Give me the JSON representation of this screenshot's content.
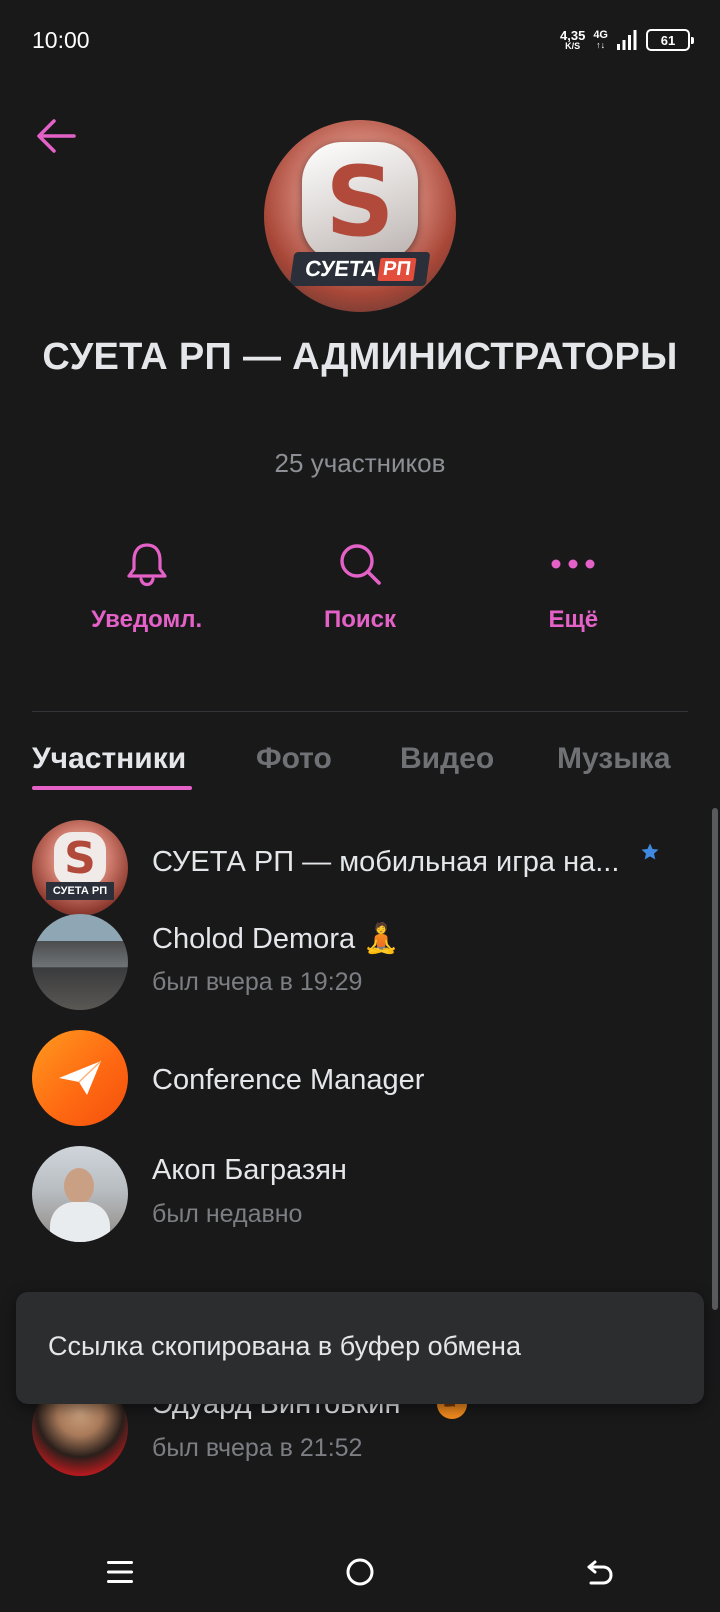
{
  "status_bar": {
    "time": "10:00",
    "net_speed_value": "4,35",
    "net_speed_unit": "K/S",
    "network_type": "4G",
    "network_arrows": "↑↓",
    "battery_level": "61"
  },
  "group": {
    "title": "СУЕТА РП — АДМИНИСТРАТОРЫ",
    "members_count": "25 участников",
    "avatar_logo_text_1": "СУЕТА",
    "avatar_logo_text_2": "РП"
  },
  "actions": [
    {
      "label": "Уведомл.",
      "icon": "bell-icon"
    },
    {
      "label": "Поиск",
      "icon": "search-icon"
    },
    {
      "label": "Ещё",
      "icon": "more-dots-icon"
    }
  ],
  "tabs": [
    {
      "label": "Участники",
      "active": true
    },
    {
      "label": "Фото",
      "active": false
    },
    {
      "label": "Видео",
      "active": false
    },
    {
      "label": "Музыка",
      "active": false
    }
  ],
  "members": [
    {
      "name": "СУЕТА РП — мобильная игра на...",
      "status": "",
      "badge": "star-icon"
    },
    {
      "name": "Cholod Demora 🧘",
      "status": "был вчера в 19:29"
    },
    {
      "name": "Conference Manager",
      "status": ""
    },
    {
      "name": "Акоп Багразян",
      "status": "был недавно"
    },
    {
      "name": "Эдуард Винтовкин",
      "status": "был вчера в 21:52",
      "badge": "dragon-emoji-icon"
    }
  ],
  "toast": {
    "text": "Ссылка скопирована в буфер обмена"
  },
  "colors": {
    "accent": "#e462c7",
    "background": "#19191a",
    "toast_bg": "#2c2d2f",
    "verified_star": "#3f8ae0"
  }
}
